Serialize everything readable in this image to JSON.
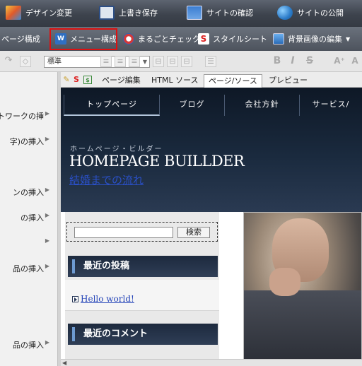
{
  "toolbar": {
    "design_change": "デザイン変更",
    "overwrite_save": "上書き保存",
    "site_check": "サイトの確認",
    "site_publish": "サイトの公開"
  },
  "toolbar2": {
    "page_structure": "ページ構成",
    "menu_structure": "メニュー構成",
    "whole_check": "まるごとチェック",
    "stylesheet": "スタイルシート",
    "bg_image_edit": "背景画像の編集"
  },
  "format_bar": {
    "style_select": "標準"
  },
  "left_panel": {
    "items": [
      "ットワークの挿",
      "字)の挿入",
      "ンの挿入",
      "の挿入",
      "",
      "品の挿入",
      "品の挿入"
    ]
  },
  "editor_tabs": {
    "page_edit": "ページ編集",
    "html_source": "HTML ソース",
    "page_source": "ページ/ソース",
    "preview": "プレビュー"
  },
  "site": {
    "nav": [
      "トップページ",
      "ブログ",
      "会社方針",
      "サービス/"
    ],
    "kana_title": "ホームページ・ビルダー",
    "logo": "HOMEPAGE BUILLDER",
    "sub_link": "結婚までの流れ",
    "search_button": "検索",
    "recent_posts_title": "最近の投稿",
    "recent_post_link": "Hello world!",
    "recent_comments_title": "最近のコメント"
  },
  "colors": {
    "accent_red": "#d11111",
    "site_header_dark": "#1a2a3e",
    "link_blue": "#2444b8"
  }
}
